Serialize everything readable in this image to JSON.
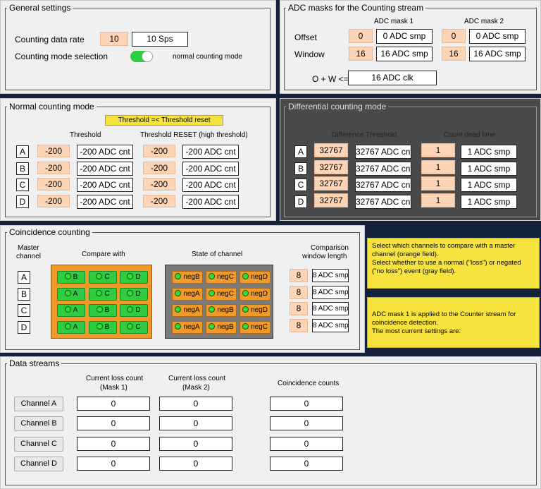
{
  "general": {
    "title": "General settings",
    "rate_label": "Counting data rate",
    "rate_value": "10",
    "rate_display": "10 Sps",
    "mode_label": "Counting mode selection",
    "mode_text": "normal counting mode"
  },
  "masks": {
    "title": "ADC masks for the Counting stream",
    "col1": "ADC mask 1",
    "col2": "ADC mask 2",
    "offset_label": "Offset",
    "window_label": "Window",
    "offset1": "0",
    "offset1_disp": "0 ADC smp",
    "offset2": "0",
    "offset2_disp": "0 ADC smp",
    "window1": "16",
    "window1_disp": "16 ADC smp",
    "window2": "16",
    "window2_disp": "16 ADC smp",
    "ow_label": "O + W <=",
    "ow_value": "16 ADC clk"
  },
  "normal": {
    "title": "Normal counting mode",
    "banner": "Threshold =< Threshold reset",
    "col_threshold": "Threshold",
    "col_reset": "Threshold RESET (high threshold)",
    "rows": [
      {
        "ch": "A",
        "thr": "-200",
        "thr_disp": "-200 ADC cnt",
        "rst": "-200",
        "rst_disp": "-200 ADC cnt"
      },
      {
        "ch": "B",
        "thr": "-200",
        "thr_disp": "-200 ADC cnt",
        "rst": "-200",
        "rst_disp": "-200 ADC cnt"
      },
      {
        "ch": "C",
        "thr": "-200",
        "thr_disp": "-200 ADC cnt",
        "rst": "-200",
        "rst_disp": "-200 ADC cnt"
      },
      {
        "ch": "D",
        "thr": "-200",
        "thr_disp": "-200 ADC cnt",
        "rst": "-200",
        "rst_disp": "-200 ADC cnt"
      }
    ]
  },
  "diff": {
    "title": "Differential counting mode",
    "col_threshold": "Difference Threshold",
    "col_dead": "Count dead time",
    "rows": [
      {
        "ch": "A",
        "thr": "32767",
        "thr_disp": "32767 ADC cnt",
        "dead": "1",
        "dead_disp": "1 ADC smp"
      },
      {
        "ch": "B",
        "thr": "32767",
        "thr_disp": "32767 ADC cnt",
        "dead": "1",
        "dead_disp": "1 ADC smp"
      },
      {
        "ch": "C",
        "thr": "32767",
        "thr_disp": "32767 ADC cnt",
        "dead": "1",
        "dead_disp": "1 ADC smp"
      },
      {
        "ch": "D",
        "thr": "32767",
        "thr_disp": "32767 ADC cnt",
        "dead": "1",
        "dead_disp": "1 ADC smp"
      }
    ]
  },
  "coinc": {
    "title": "Coincidence counting",
    "col_master_1": "Master",
    "col_master_2": "channel",
    "col_compare": "Compare with",
    "col_state": "State of channel",
    "col_window_1": "Comparison",
    "col_window_2": "window length",
    "rows": [
      {
        "ch": "A",
        "cmp": [
          "B",
          "C",
          "D"
        ],
        "state": [
          "negB",
          "negC",
          "negD"
        ],
        "win": "8",
        "win_disp": "8 ADC smp"
      },
      {
        "ch": "B",
        "cmp": [
          "A",
          "C",
          "D"
        ],
        "state": [
          "negA",
          "negC",
          "negD"
        ],
        "win": "8",
        "win_disp": "8 ADC smp"
      },
      {
        "ch": "C",
        "cmp": [
          "A",
          "B",
          "D"
        ],
        "state": [
          "negA",
          "negB",
          "negD"
        ],
        "win": "8",
        "win_disp": "8 ADC smp"
      },
      {
        "ch": "D",
        "cmp": [
          "A",
          "B",
          "C"
        ],
        "state": [
          "negA",
          "negB",
          "negC"
        ],
        "win": "8",
        "win_disp": "8 ADC smp"
      }
    ],
    "colors": {
      "green": "#2ecc40",
      "orange": "#f19a2a"
    }
  },
  "info": {
    "box1": "Select which channels to compare with a master channel (orange field).\nSelect whether to use a normal (\"loss\") or negated (\"no loss\") event (gray field).",
    "box2": "ADC mask 1 is applied to the Counter stream for coincidence detection.\nThe most current settings are:"
  },
  "streams": {
    "title": "Data streams",
    "col1_1": "Current loss count",
    "col1_2": "(Mask 1)",
    "col2_1": "Current loss count",
    "col2_2": "(Mask 2)",
    "col3": "Coincidence counts",
    "rows": [
      {
        "label": "Channel A",
        "m1": "0",
        "m2": "0",
        "cc": "0"
      },
      {
        "label": "Channel B",
        "m1": "0",
        "m2": "0",
        "cc": "0"
      },
      {
        "label": "Channel C",
        "m1": "0",
        "m2": "0",
        "cc": "0"
      },
      {
        "label": "Channel D",
        "m1": "0",
        "m2": "0",
        "cc": "0"
      }
    ]
  }
}
